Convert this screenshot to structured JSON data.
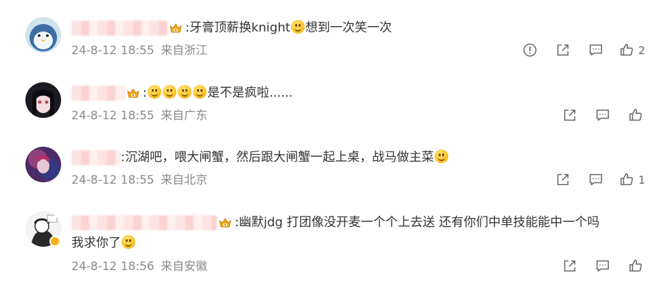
{
  "comments": [
    {
      "name_blurred": "",
      "text": ":牙膏顶薪换knight",
      "text_after": "想到一次笑一次",
      "time": "24-8-12 18:55",
      "location": "来自浙江",
      "likes": "2",
      "has_report": true
    },
    {
      "name_blurred": "",
      "text": ":",
      "text_after": "是不是疯啦......",
      "time": "24-8-12 18:55",
      "location": "来自广东",
      "likes": "",
      "has_report": false
    },
    {
      "name_blurred": "",
      "text": ":沉湖吧，喂大闸蟹，然后跟大闸蟹一起上桌，战马做主菜",
      "text_after": "",
      "time": "24-8-12 18:55",
      "location": "来自北京",
      "likes": "1",
      "has_report": false
    },
    {
      "name_blurred": "",
      "text": ":幽默jdg 打团像没开麦一个个上去送 还有你们中单技能能中一个吗",
      "text_line2": "我求你了",
      "time": "24-8-12 18:56",
      "location": "来自安徽",
      "likes": "",
      "has_report": false
    }
  ],
  "icons": {
    "report": "report-icon",
    "share": "share-icon",
    "reply": "comment-icon",
    "like": "thumbs-up-icon",
    "badge": "crown-badge-icon",
    "verified": "verified-badge-icon"
  },
  "colors": {
    "meta_text": "#8a8a8a",
    "icon": "#6d6d6d",
    "emoji": "#fbc52a",
    "verified": "#f5b21b"
  }
}
